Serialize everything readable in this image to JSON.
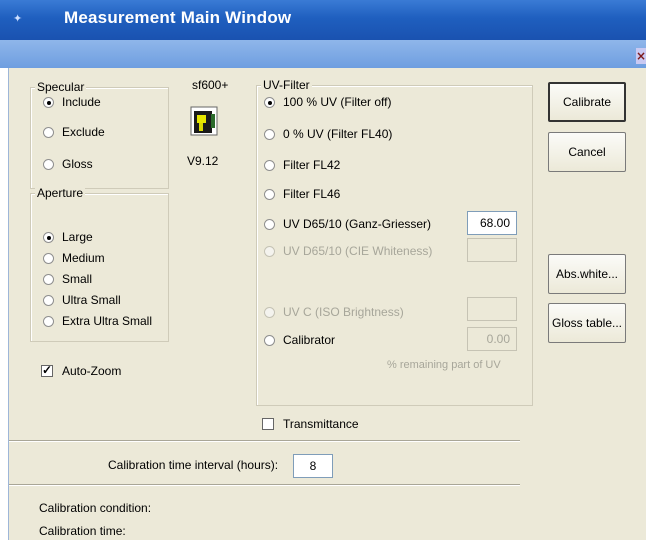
{
  "window": {
    "title": "Measurement Main Window",
    "close_glyph": "×"
  },
  "specular": {
    "legend": "Specular",
    "options": [
      {
        "label": "Include",
        "checked": true
      },
      {
        "label": "Exclude",
        "checked": false
      },
      {
        "label": "Gloss",
        "checked": false
      }
    ]
  },
  "device": {
    "name": "sf600+",
    "version": "V9.12",
    "icon": "instrument-icon"
  },
  "aperture": {
    "legend": "Aperture",
    "options": [
      {
        "label": "Large",
        "checked": true
      },
      {
        "label": "Medium",
        "checked": false
      },
      {
        "label": "Small",
        "checked": false
      },
      {
        "label": "Ultra Small",
        "checked": false
      },
      {
        "label": "Extra Ultra Small",
        "checked": false
      }
    ]
  },
  "auto_zoom": {
    "label": "Auto-Zoom",
    "checked": true
  },
  "uv_filter": {
    "legend": "UV-Filter",
    "options": [
      {
        "label": "100 % UV (Filter off)",
        "checked": true,
        "enabled": true
      },
      {
        "label": "0 % UV (Filter FL40)",
        "checked": false,
        "enabled": true
      },
      {
        "label": "Filter FL42",
        "checked": false,
        "enabled": true
      },
      {
        "label": "Filter FL46",
        "checked": false,
        "enabled": true
      },
      {
        "label": "UV D65/10 (Ganz-Griesser)",
        "checked": false,
        "enabled": true,
        "value": "68.00"
      },
      {
        "label": "UV D65/10 (CIE Whiteness)",
        "checked": false,
        "enabled": false,
        "value": ""
      },
      {
        "label": "UV C (ISO Brightness)",
        "checked": false,
        "enabled": false,
        "value": ""
      },
      {
        "label": "Calibrator",
        "checked": false,
        "enabled": true,
        "value": "0.00"
      }
    ],
    "remaining_note": "% remaining part of UV"
  },
  "transmittance": {
    "label": "Transmittance",
    "checked": false
  },
  "buttons": {
    "calibrate": "Calibrate",
    "cancel": "Cancel",
    "abs_white": "Abs.white...",
    "gloss_table": "Gloss table..."
  },
  "calibration": {
    "interval_label": "Calibration time interval (hours):",
    "interval_value": "8",
    "condition_label": "Calibration condition:",
    "time_label": "Calibration time:"
  },
  "colors": {
    "title_bar": "#1f5fbf",
    "dialog_bg": "#ece9d8"
  }
}
